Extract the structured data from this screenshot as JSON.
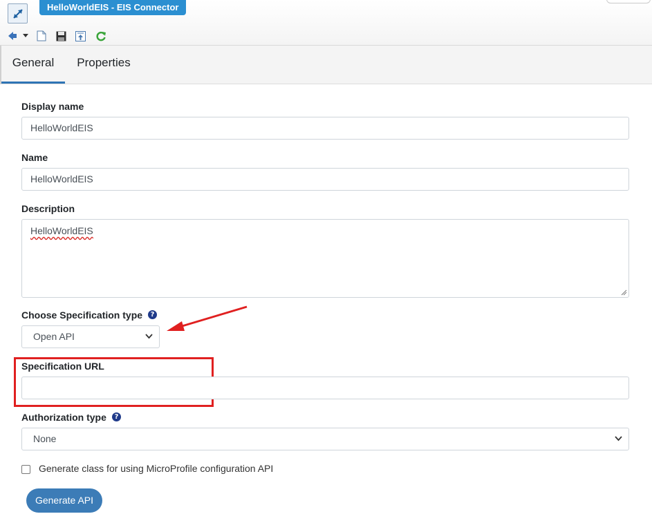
{
  "window": {
    "title": "HelloWorldEIS - EIS Connector",
    "app_icon": "connector-arrow-icon"
  },
  "toolbar": {
    "icons": [
      "back-dropdown-icon",
      "chevron-down-icon",
      "new-file-icon",
      "save-icon",
      "export-icon",
      "refresh-icon"
    ]
  },
  "tabs": [
    {
      "label": "General",
      "active": true
    },
    {
      "label": "Properties",
      "active": false
    }
  ],
  "form": {
    "display_name": {
      "label": "Display name",
      "value": "HelloWorldEIS"
    },
    "name": {
      "label": "Name",
      "value": "HelloWorldEIS"
    },
    "description": {
      "label": "Description",
      "value": "HelloWorldEIS"
    },
    "spec_type": {
      "label": "Choose Specification type",
      "selected": "Open API"
    },
    "spec_url": {
      "label": "Specification URL",
      "value": ""
    },
    "auth_type": {
      "label": "Authorization type",
      "selected": "None"
    },
    "microprofile": {
      "label": "Generate class for using MicroProfile configuration API",
      "checked": false
    },
    "submit_label": "Generate API"
  },
  "colors": {
    "accent": "#2b8fd1",
    "button": "#3c7cb7",
    "annotation_red": "#e02020",
    "help_icon": "#1f3a8a"
  }
}
